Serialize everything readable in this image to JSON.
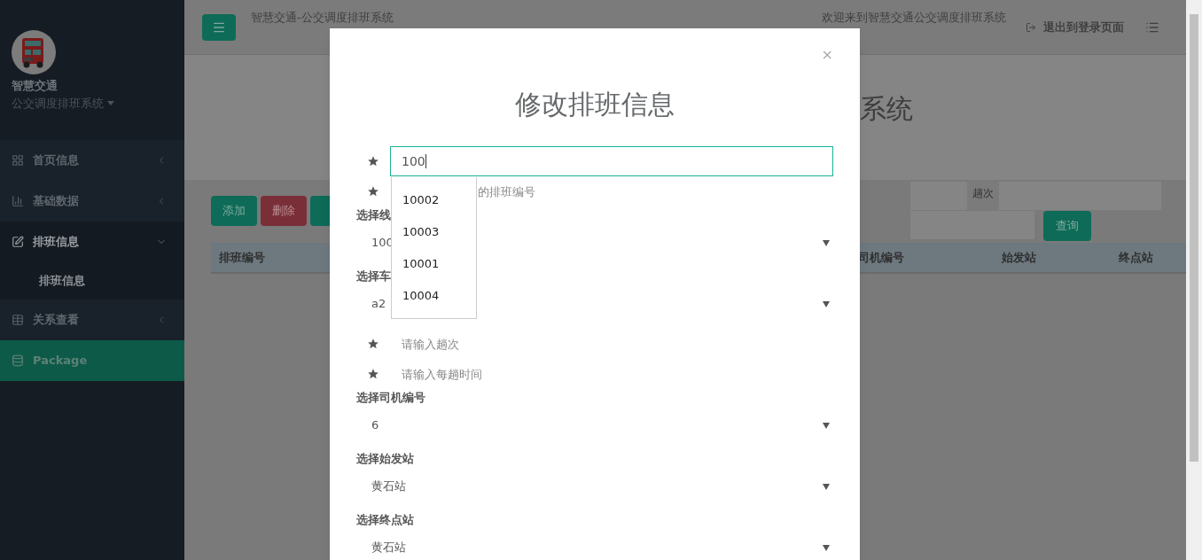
{
  "sidebar": {
    "brand_title": "智慧交通",
    "brand_subtitle": "公交调度排班系统",
    "items": [
      {
        "label": "首页信息",
        "expanded": false,
        "selected": false
      },
      {
        "label": "基础数据",
        "expanded": false,
        "selected": false
      },
      {
        "label": "排班信息",
        "expanded": true,
        "selected": false,
        "children": [
          {
            "label": "排班信息"
          }
        ]
      },
      {
        "label": "关系查看",
        "expanded": false,
        "selected": false
      },
      {
        "label": "Package",
        "expanded": false,
        "selected": true
      }
    ]
  },
  "topbar": {
    "title": "智慧交通-公交调度排班系统",
    "welcome": "欢迎来到智慧交通公交调度排班系统",
    "logout": "退出到登录页面"
  },
  "page": {
    "heading_fragment": "系统",
    "buttons": [
      {
        "label": "添加",
        "kind": "primary"
      },
      {
        "label": "删除",
        "kind": "danger"
      },
      {
        "kind": "primary"
      }
    ],
    "trips_label": "趟次",
    "query_button": "查询",
    "columns": [
      "排班编号",
      "司机编号",
      "始发站",
      "终点站"
    ]
  },
  "modal": {
    "title": "修改排班信息",
    "close": "×",
    "id_value": "100",
    "suggestions": [
      "10002",
      "10003",
      "10001",
      "10004"
    ],
    "fields": [
      {
        "kind": "input",
        "placeholder": "的排班编号"
      },
      {
        "kind": "select",
        "label": "选择线",
        "value": "100"
      },
      {
        "kind": "select",
        "label": "选择车",
        "value": "a2"
      },
      {
        "kind": "input",
        "placeholder": "请输入趟次"
      },
      {
        "kind": "input",
        "placeholder": "请输入每趟时间"
      },
      {
        "kind": "select",
        "label": "选择司机编号",
        "value": "6"
      },
      {
        "kind": "select",
        "label": "选择始发站",
        "value": "黄石站"
      },
      {
        "kind": "select",
        "label": "选择终点站",
        "value": "黄石站"
      }
    ]
  }
}
